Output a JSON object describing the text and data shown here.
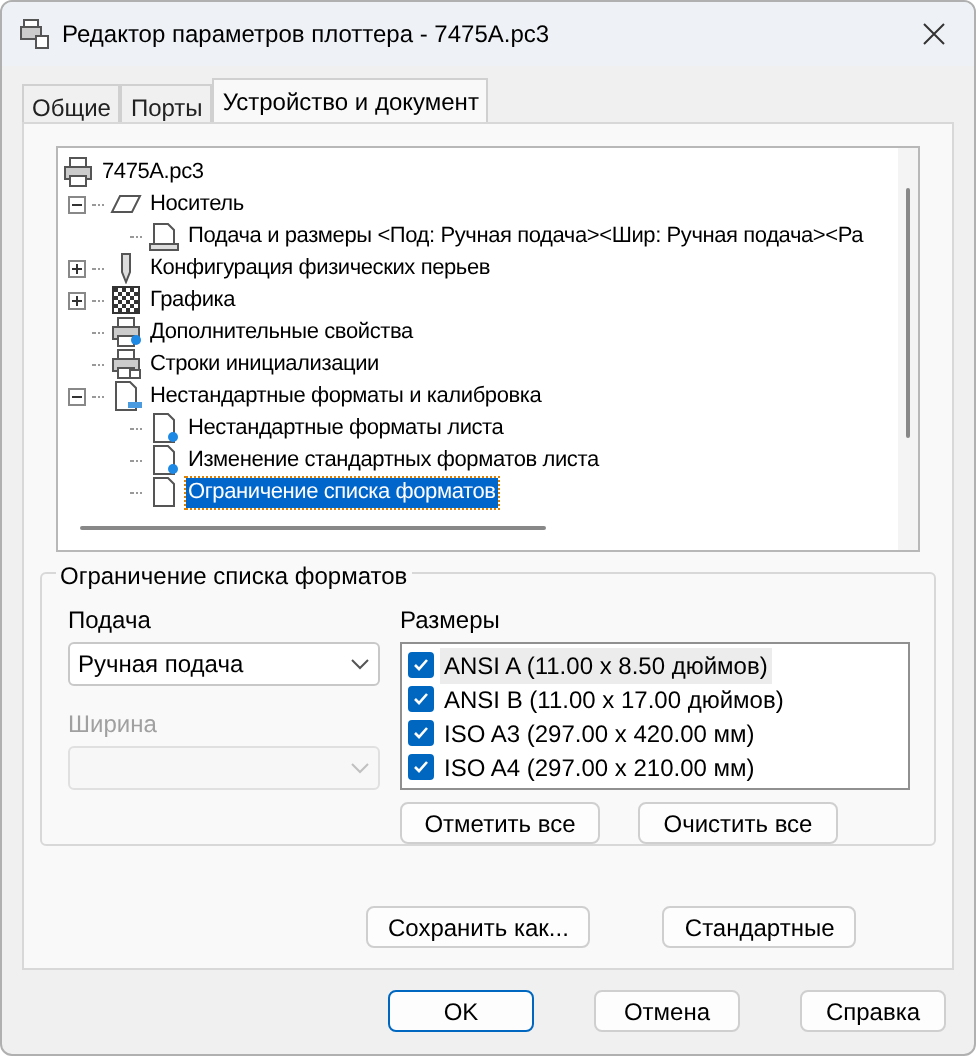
{
  "window": {
    "title": "Редактор параметров плоттера - 7475A.pc3"
  },
  "tabs": [
    {
      "label": "Общие",
      "selected": false
    },
    {
      "label": "Порты",
      "selected": false
    },
    {
      "label": "Устройство и документ",
      "selected": true
    }
  ],
  "tree": [
    {
      "label": "7475A.pc3",
      "kind": "printer",
      "selected": false,
      "children": [
        {
          "label": "Носитель",
          "kind": "media",
          "selected": false,
          "expanded": true,
          "children": [
            {
              "label": "Подача и размеры  <Под:  Ручная подача><Шир: Ручная подача><Ра",
              "kind": "tray",
              "selected": false
            }
          ]
        },
        {
          "label": "Конфигурация физических перьев",
          "kind": "pen",
          "selected": false,
          "expanded": false
        },
        {
          "label": "Графика",
          "kind": "grid",
          "selected": false,
          "expanded": false
        },
        {
          "label": "Дополнительные свойства",
          "kind": "printer-user",
          "selected": false
        },
        {
          "label": "Строки инициализации",
          "kind": "printer-doc",
          "selected": false
        },
        {
          "label": "Нестандартные форматы и калибровка",
          "kind": "page-bar",
          "selected": false,
          "expanded": true,
          "children": [
            {
              "label": "Нестандартные форматы листа",
              "kind": "page-user",
              "selected": false
            },
            {
              "label": "Изменение стандартных форматов листа",
              "kind": "page-user",
              "selected": false
            },
            {
              "label": "Ограничение списка форматов",
              "kind": "page",
              "selected": true
            }
          ]
        }
      ]
    }
  ],
  "group": {
    "title": "Ограничение списка форматов",
    "source": {
      "label": "Подача",
      "value": "Ручная подача",
      "disabled": false
    },
    "width": {
      "label": "Ширина",
      "disabled": true
    },
    "sizes_label": "Размеры",
    "sizes": [
      {
        "label": "ANSI A (11.00 x 8.50 дюймов)",
        "checked": true,
        "selected": true
      },
      {
        "label": "ANSI B (11.00 x 17.00 дюймов)",
        "checked": true,
        "selected": false
      },
      {
        "label": "ISO A3 (297.00 x 420.00 мм)",
        "checked": true,
        "selected": false
      },
      {
        "label": "ISO A4 (297.00 x 210.00 мм)",
        "checked": true,
        "selected": false
      }
    ],
    "list_buttons": [
      "Отметить все",
      "Очистить все"
    ]
  },
  "page_buttons": [
    "Сохранить как...",
    "Стандартные"
  ],
  "dialog_buttons": [
    {
      "label": "OK",
      "default": true
    },
    {
      "label": "Отмена",
      "default": false
    },
    {
      "label": "Справка",
      "default": false
    }
  ]
}
